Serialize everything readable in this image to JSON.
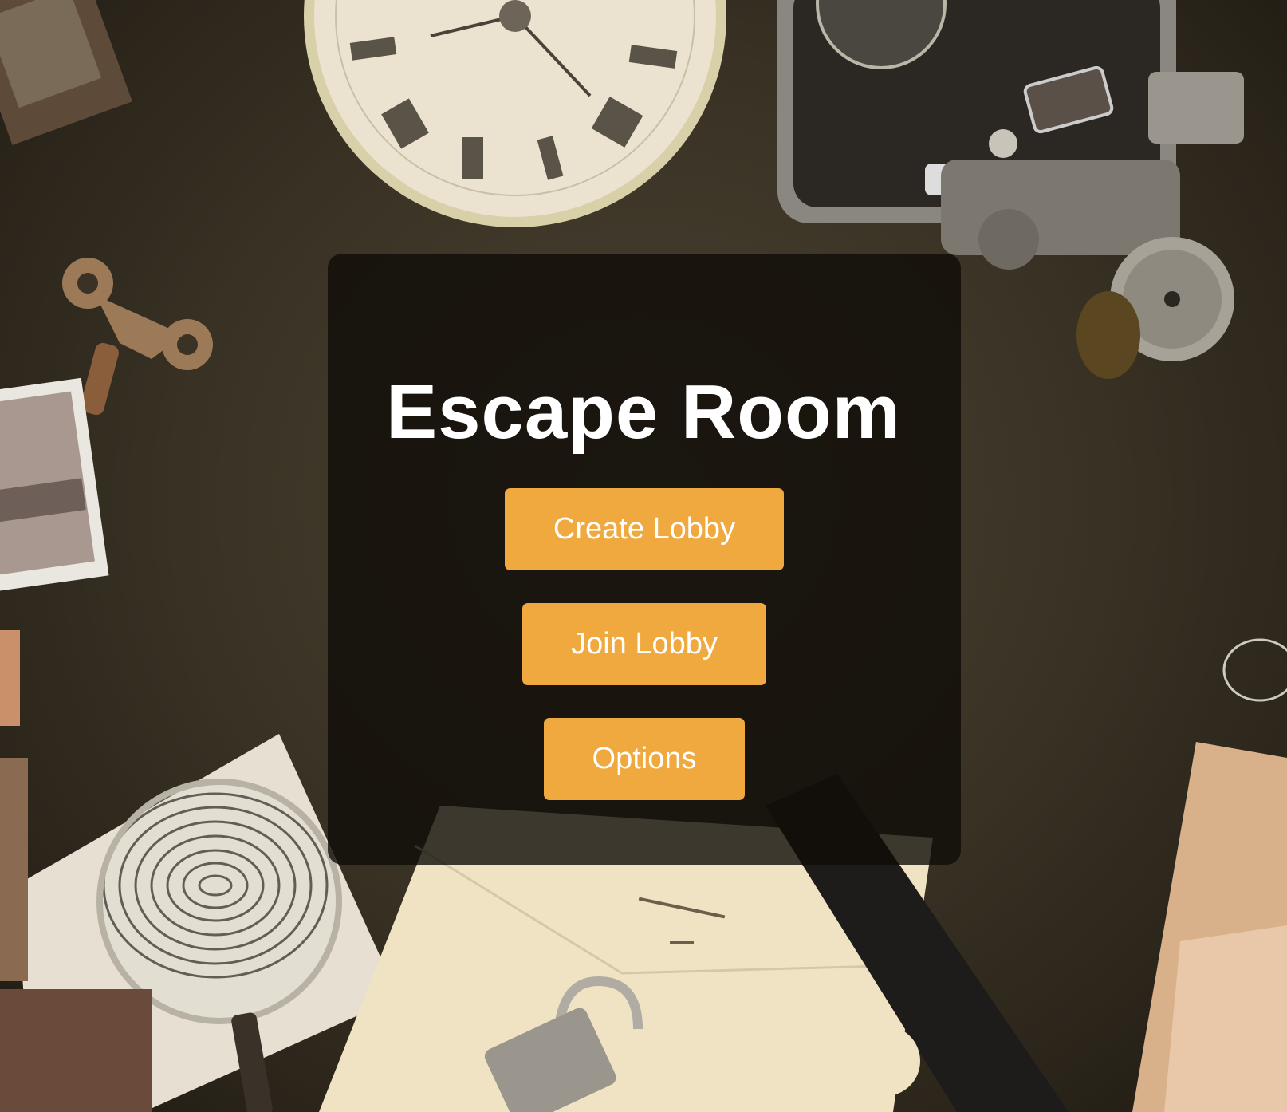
{
  "game": {
    "title": "Escape Room"
  },
  "menu": {
    "create_lobby_label": "Create Lobby",
    "join_lobby_label": "Join Lobby",
    "options_label": "Options"
  },
  "colors": {
    "button_bg": "#f0a93e",
    "button_text": "#ffffff",
    "title_text": "#ffffff",
    "panel_bg": "rgba(15,12,8,0.80)"
  },
  "background": {
    "icons": [
      "clock-icon",
      "camera-icon",
      "key-icon",
      "photo-icon",
      "magnifier-icon",
      "fingerprint-icon",
      "envelope-icon",
      "padlock-icon",
      "pistol-icon",
      "film-reel-icon"
    ]
  }
}
